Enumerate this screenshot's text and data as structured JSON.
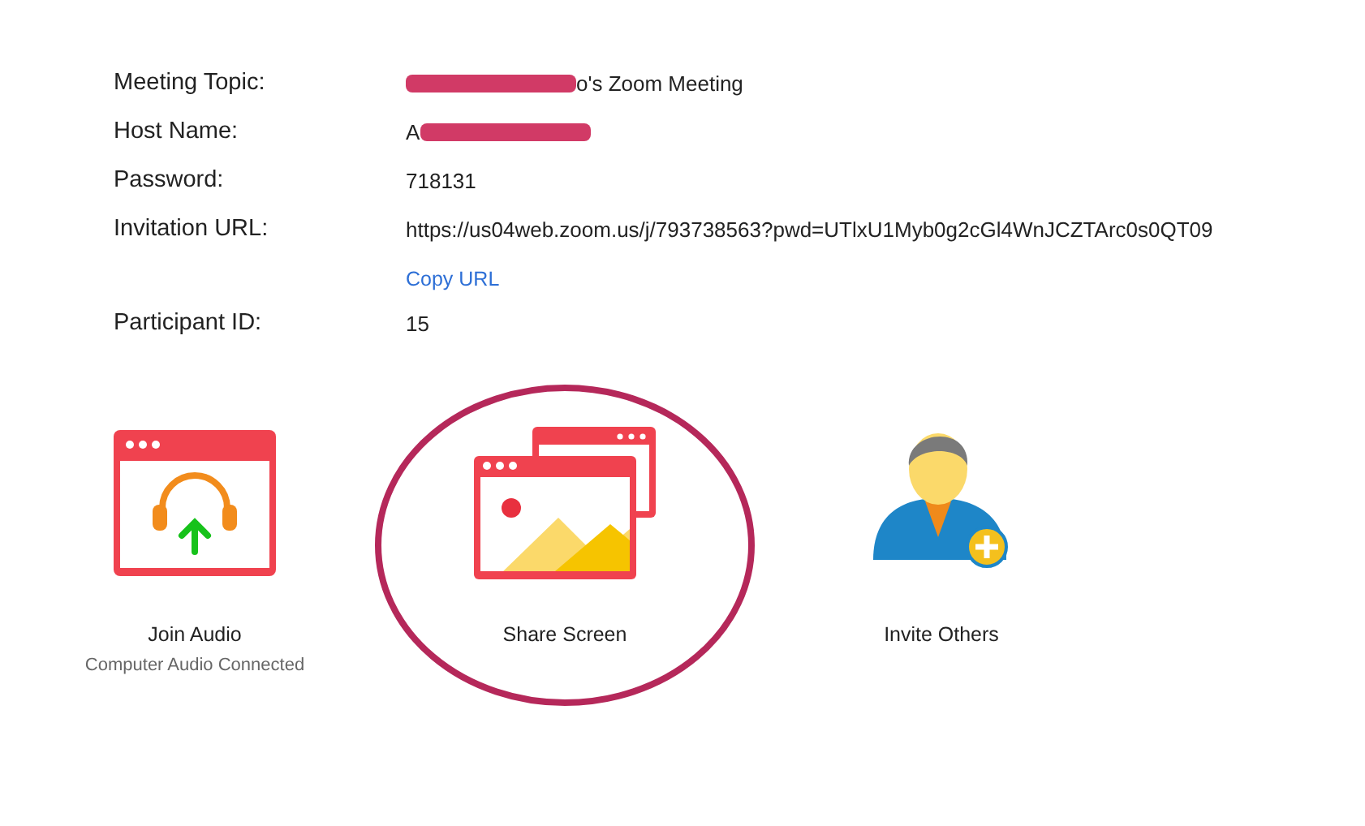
{
  "details": [
    {
      "label": "Meeting Topic:",
      "value": "o's Zoom Meeting",
      "redacted_before": true,
      "redacted_after": false
    },
    {
      "label": "Host Name:",
      "value": "A",
      "redacted_before": false,
      "redacted_after": true
    },
    {
      "label": "Password:",
      "value": "718131",
      "redacted_before": false,
      "redacted_after": false
    },
    {
      "label": "Invitation URL:",
      "value": "https://us04web.zoom.us/j/793738563?pwd=UTlxU1Myb0g2cGl4WnJCZTArc0s0QT09",
      "link": "Copy URL",
      "redacted_before": false,
      "redacted_after": false
    },
    {
      "label": "Participant ID:",
      "value": "15",
      "redacted_before": false,
      "redacted_after": false
    }
  ],
  "actions": [
    {
      "kind": "audio",
      "label": "Join Audio",
      "status": "Computer Audio Connected",
      "highlighted": false
    },
    {
      "kind": "share",
      "label": "Share Screen",
      "highlighted": true
    },
    {
      "kind": "invite",
      "label": "Invite Others",
      "highlighted": false
    }
  ]
}
